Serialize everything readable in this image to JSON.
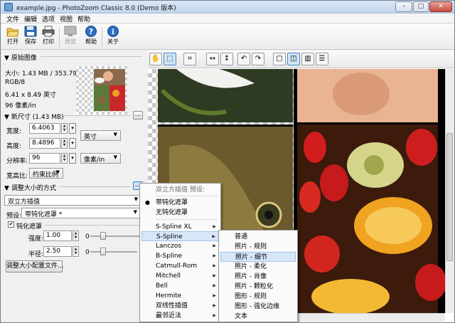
{
  "window": {
    "title": "example.jpg - PhotoZoom Classic 8.0 (Demo 版本)",
    "minimize": "–",
    "maximize": "□",
    "close": "✕"
  },
  "menu": [
    "文件",
    "编辑",
    "选项",
    "视图",
    "帮助"
  ],
  "toolbar": [
    {
      "label": "打开",
      "icon": "folder-open-icon"
    },
    {
      "label": "保存",
      "icon": "floppy-save-icon"
    },
    {
      "label": "打印",
      "icon": "printer-icon"
    },
    {
      "label": "预览",
      "icon": "preview-monitor-icon"
    },
    {
      "label": "帮助",
      "icon": "help-question-icon"
    },
    {
      "label": "关于",
      "icon": "info-icon"
    }
  ],
  "original": {
    "heading": "原始图像",
    "size": "大小: 1.43 MB / 353.79 KB",
    "mode": "RGB/8",
    "dimensions": "6.41 x 8.49 英寸",
    "resolution": "96 像素/in"
  },
  "newsize": {
    "heading": "新尺寸 (1.43 MB)",
    "more_button": "...",
    "width_label": "宽度:",
    "width_value": "6.4063",
    "height_label": "高度:",
    "height_value": "8.4896",
    "resolution_label": "分辨率:",
    "resolution_value": "96",
    "unit": "英寸",
    "res_unit": "像素/in",
    "aspect_label": "宽高比:",
    "aspect_value": "约束比例"
  },
  "method": {
    "heading": "调整大小的方式",
    "more_button": "...",
    "method_value": "双立方插值",
    "preset_label": "预设:",
    "preset_value": "带钝化遮罩 *",
    "unsharp_label": "钝化遮罩",
    "unsharp_checked": "✔",
    "strength_label": "强度:",
    "strength_value": "1.00",
    "strength_min": "0",
    "radius_label": "半径:",
    "radius_value": "2.50",
    "radius_min": "0",
    "radius_max": "1",
    "config_button": "调整大小配置文件..."
  },
  "preview_toolbar": [
    "hand-tool-icon",
    "select-tool-icon",
    "crop-icon",
    "fit-width-icon",
    "fit-height-icon",
    "rotate-left-icon",
    "rotate-right-icon",
    "single-view-icon",
    "split-view-icon",
    "side-by-side-icon",
    "stacked-view-icon"
  ],
  "context_menu": {
    "header": "双立方插值 预设:",
    "items": [
      "带钝化遮罩",
      "无钝化遮罩"
    ],
    "checked_item": "带钝化遮罩",
    "methods": [
      "S-Spline XL",
      "S-Spline",
      "Lanczos",
      "B-Spline",
      "Catmull-Rom",
      "Mitchell",
      "Bell",
      "Hermite",
      "双线性插值",
      "最邻近法"
    ],
    "highlighted": "S-Spline"
  },
  "submenu": {
    "items": [
      "普通",
      "照片 - 规则",
      "照片 - 细节",
      "照片 - 柔化",
      "照片 - 肖像",
      "照片 - 颗粒化",
      "图形 - 规则",
      "图形 - 强化边缘",
      "文本"
    ],
    "highlighted": "照片 - 细节"
  },
  "colors": {
    "accent": "#3d7ec6",
    "highlight": "#d6e7f8"
  }
}
